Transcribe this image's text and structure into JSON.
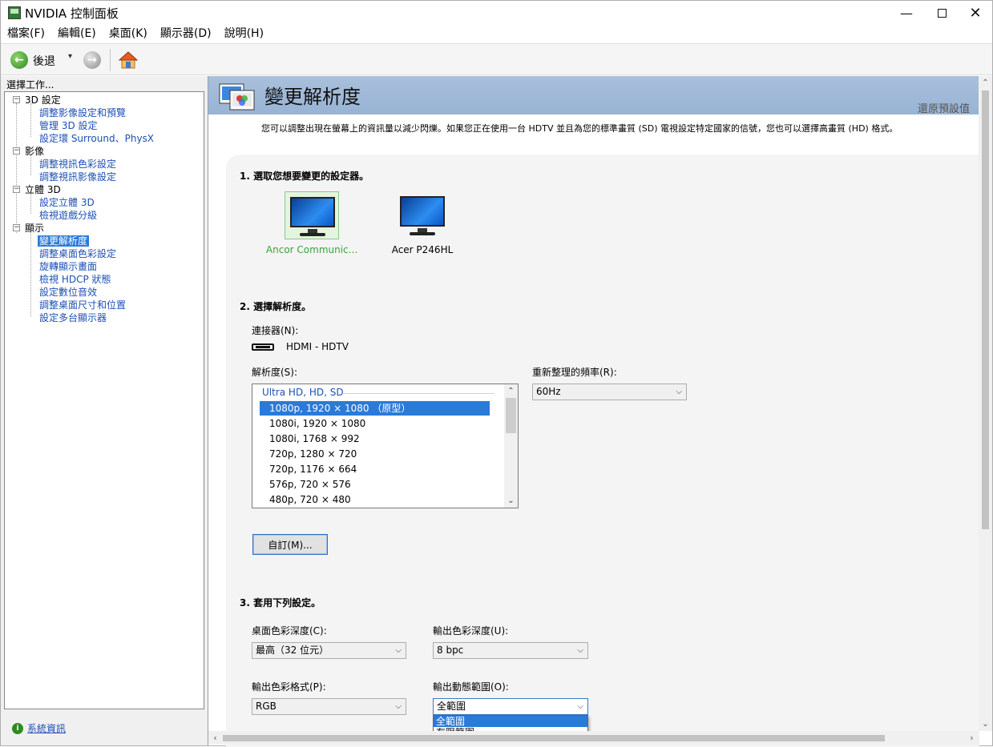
{
  "window": {
    "title": "NVIDIA 控制面板",
    "minimize": "—",
    "close": "✕"
  },
  "menu": [
    {
      "label": "檔案(F)"
    },
    {
      "label": "編輯(E)"
    },
    {
      "label": "桌面(K)"
    },
    {
      "label": "顯示器(D)"
    },
    {
      "label": "說明(H)"
    }
  ],
  "toolbar": {
    "back_label": "後退",
    "back_arrow": "←",
    "forward_arrow": "→",
    "dropdown": "▾"
  },
  "left_pane": {
    "title": "選擇工作...",
    "tree": [
      {
        "label": "3D 設定",
        "type": "category",
        "expander": "−"
      },
      {
        "label": "調整影像設定和預覽",
        "type": "link"
      },
      {
        "label": "管理 3D 設定",
        "type": "link"
      },
      {
        "label": "設定環 Surround、PhysX",
        "type": "link"
      },
      {
        "label": "影像",
        "type": "category",
        "expander": "−"
      },
      {
        "label": "調整視訊色彩設定",
        "type": "link"
      },
      {
        "label": "調整視訊影像設定",
        "type": "link"
      },
      {
        "label": "立體 3D",
        "type": "category",
        "expander": "−"
      },
      {
        "label": "設定立體 3D",
        "type": "link"
      },
      {
        "label": "檢視遊戲分級",
        "type": "link"
      },
      {
        "label": "顯示",
        "type": "category",
        "expander": "−"
      },
      {
        "label": "變更解析度",
        "type": "link",
        "selected": true
      },
      {
        "label": "調整桌面色彩設定",
        "type": "link"
      },
      {
        "label": "旋轉顯示畫面",
        "type": "link"
      },
      {
        "label": "檢視 HDCP 狀態",
        "type": "link"
      },
      {
        "label": "設定數位音效",
        "type": "link"
      },
      {
        "label": "調整桌面尺寸和位置",
        "type": "link"
      },
      {
        "label": "設定多台顯示器",
        "type": "link"
      }
    ],
    "system_info": "系統資訊",
    "system_info_icon": "i"
  },
  "page": {
    "title": "變更解析度",
    "restore_defaults": "還原預設值",
    "description": "您可以調整出現在螢幕上的資訊量以減少閃爍。如果您正在使用一台 HDTV 並且為您的標準畫質 (SD) 電視設定特定國家的信號，您也可以選擇高畫質 (HD) 格式。",
    "section1_title": "1. 選取您想要變更的設定器。",
    "displays": [
      {
        "name": "Ancor Communic...",
        "selected": true
      },
      {
        "name": "Acer P246HL",
        "selected": false
      }
    ],
    "section2_title": "2. 選擇解析度。",
    "connector_label": "連接器(N):",
    "connector_value": "HDMI - HDTV",
    "resolution_label": "解析度(S):",
    "resolution_group": "Ultra HD, HD, SD",
    "resolutions": [
      {
        "label": "1080p, 1920 × 1080 （原型）",
        "selected": true
      },
      {
        "label": "1080i, 1920 × 1080"
      },
      {
        "label": "1080i, 1768 × 992"
      },
      {
        "label": "720p, 1280 × 720"
      },
      {
        "label": "720p, 1176 × 664"
      },
      {
        "label": "576p, 720 × 576"
      },
      {
        "label": "480p, 720 × 480"
      }
    ],
    "refresh_label": "重新整理的頻率(R):",
    "refresh_value": "60Hz",
    "custom_button": "自訂(M)...",
    "section3_title": "3. 套用下列設定。",
    "desktop_depth_label": "桌面色彩深度(C):",
    "desktop_depth_value": "最高（32 位元）",
    "output_depth_label": "輸出色彩深度(U):",
    "output_depth_value": "8 bpc",
    "output_format_label": "輸出色彩格式(P):",
    "output_format_value": "RGB",
    "output_range_label": "輸出動態範圍(O):",
    "output_range_value": "全範圍",
    "output_range_options": [
      {
        "label": "全範圍",
        "selected": true
      },
      {
        "label": "有限範圍"
      }
    ],
    "chevron": "⌵",
    "up_arrow": "⌃",
    "down_arrow": "⌄",
    "left_arrow": "‹",
    "right_arrow": "›"
  }
}
